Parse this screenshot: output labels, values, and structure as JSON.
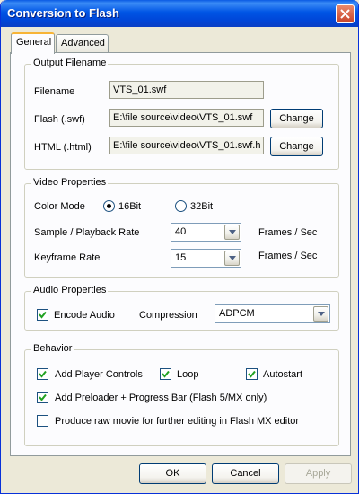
{
  "window": {
    "title": "Conversion to Flash"
  },
  "tabs": [
    {
      "label": "General"
    },
    {
      "label": "Advanced"
    }
  ],
  "output_filename": {
    "title": "Output Filename",
    "filename_label": "Filename",
    "filename_value": "VTS_01.swf",
    "flash_label": "Flash (.swf)",
    "flash_value": "E:\\file source\\video\\VTS_01.swf",
    "html_label": "HTML (.html)",
    "html_value": "E:\\file source\\video\\VTS_01.swf.h",
    "change_label": "Change"
  },
  "video_properties": {
    "title": "Video Properties",
    "color_mode_label": "Color Mode",
    "option_16bit": "16Bit",
    "option_32bit": "32Bit",
    "selected": "16Bit",
    "sample_rate_label": "Sample / Playback  Rate",
    "sample_rate_value": "40",
    "keyframe_label": "Keyframe  Rate",
    "keyframe_value": "15",
    "unit": "Frames / Sec"
  },
  "audio_properties": {
    "title": "Audio Properties",
    "encode_audio_label": "Encode Audio",
    "encode_audio_checked": true,
    "compression_label": "Compression",
    "compression_value": "ADPCM"
  },
  "behavior": {
    "title": "Behavior",
    "player_controls_label": "Add Player Controls",
    "player_controls_checked": true,
    "loop_label": "Loop",
    "loop_checked": true,
    "autostart_label": "Autostart",
    "autostart_checked": true,
    "preloader_label": "Add Preloader + Progress Bar  (Flash 5/MX only)",
    "preloader_checked": true,
    "raw_movie_label": "Produce raw movie for further editing in Flash MX editor",
    "raw_movie_checked": false
  },
  "buttons": {
    "ok": "OK",
    "cancel": "Cancel",
    "apply": "Apply"
  }
}
